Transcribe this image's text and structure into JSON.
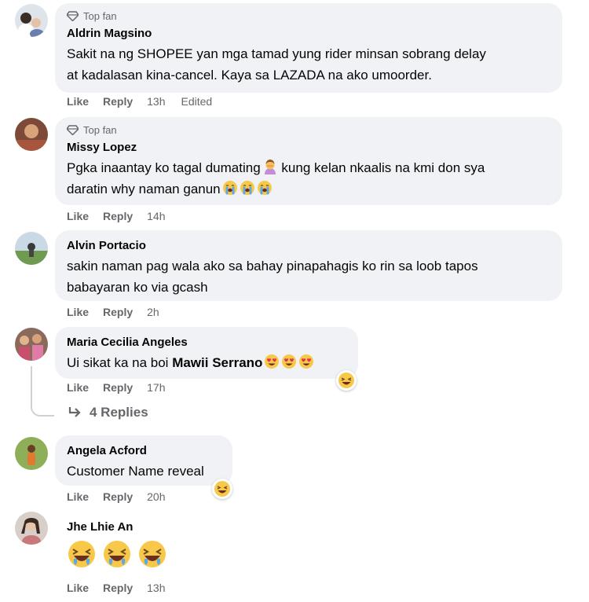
{
  "comments": [
    {
      "badge": "Top fan",
      "author": "Aldrin Magsino",
      "lines": [
        "Sakit na ng SHOPEE yan mga tamad yung rider minsan sobrang delay",
        "at kadalasan kina-cancel. Kaya sa LAZADA na ako umoorder."
      ],
      "like": "Like",
      "reply": "Reply",
      "time": "13h",
      "edited": "Edited"
    },
    {
      "badge": "Top fan",
      "author": "Missy Lopez",
      "line1": "Pgka inaantay ko tagal dumating",
      "line1b": "kung kelan nkaalis na kmi don sya",
      "line2": "daratin why naman ganun",
      "like": "Like",
      "reply": "Reply",
      "time": "14h"
    },
    {
      "author": "Alvin Portacio",
      "lines": [
        "sakin naman pag wala ako sa bahay pinapahagis ko rin sa loob tapos",
        "babayaran ko via gcash"
      ],
      "like": "Like",
      "reply": "Reply",
      "time": "2h"
    },
    {
      "author": "Maria Cecilia Angeles",
      "text": "Ui sikat ka na boi",
      "mention": "Mawii Serrano",
      "like": "Like",
      "reply": "Reply",
      "time": "17h",
      "replies_label": "4 Replies"
    },
    {
      "author": "Angela Acford",
      "text": "Customer Name reveal",
      "like": "Like",
      "reply": "Reply",
      "time": "20h"
    },
    {
      "author": "Jhe Lhie An",
      "like": "Like",
      "reply": "Reply",
      "time": "13h"
    }
  ],
  "icons": {
    "badge": "diamond-icon",
    "reply_arrow": "reply-arrow-icon",
    "emoji_laugh": "tears-of-joy-emoji",
    "emoji_crying": "loudly-crying-emoji",
    "emoji_hearts": "heart-eyes-emoji",
    "emoji_facepalm": "person-facepalming-emoji",
    "reaction_haha": "haha-reaction-icon"
  },
  "colors": {
    "bubble": "#f0f2f5",
    "secondary_text": "#65676b",
    "primary_text": "#050505"
  }
}
